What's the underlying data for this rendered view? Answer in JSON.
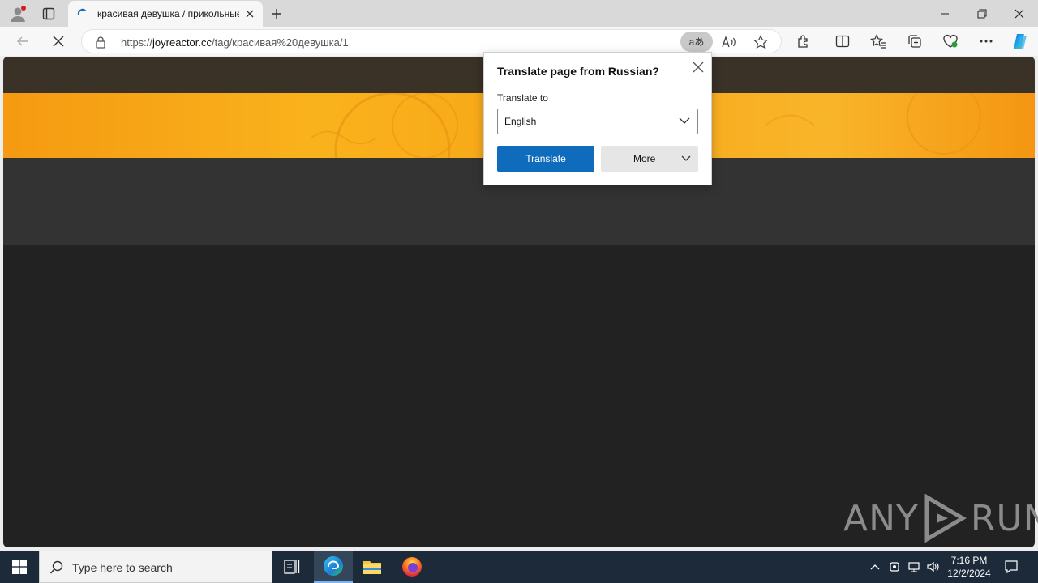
{
  "browser": {
    "tab": {
      "title": "красивая девушка / прикольные"
    },
    "address_bar": {
      "url_prefix": "https://",
      "url_host": "joyreactor.cc",
      "url_path": "/tag/красивая%20девушка/1"
    },
    "translate_chip_label": "aあ"
  },
  "translate_popup": {
    "title": "Translate page from Russian?",
    "label": "Translate to",
    "selected_language": "English",
    "translate_button": "Translate",
    "more_button": "More"
  },
  "watermark": {
    "left": "ANY",
    "right": "RUN"
  },
  "taskbar": {
    "search_placeholder": "Type here to search",
    "time": "7:16 PM",
    "date": "12/2/2024"
  },
  "colors": {
    "accent": "#0f6cbd",
    "banner": "#f8a617",
    "page_bg": "#222222"
  }
}
